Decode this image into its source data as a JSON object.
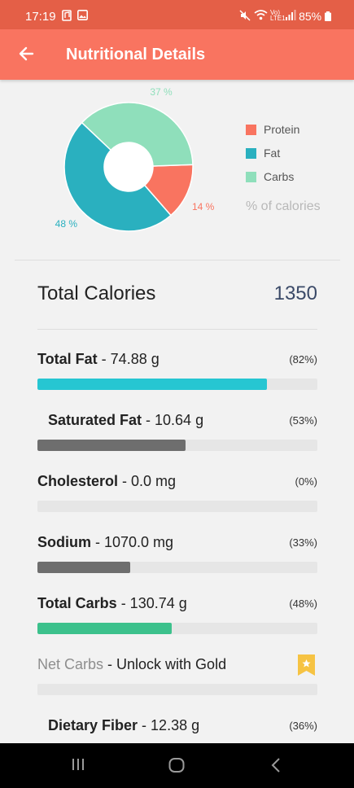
{
  "status_bar": {
    "time": "17:19",
    "battery": "85%",
    "icons": [
      "music-note-icon",
      "image-icon",
      "mute-icon",
      "wifi-icon",
      "volte-icon",
      "signal-icon",
      "battery-icon"
    ]
  },
  "app_bar": {
    "title": "Nutritional Details",
    "back_icon": "arrow-left-icon"
  },
  "chart_data": {
    "type": "pie",
    "donut": true,
    "unit": "% of calories",
    "series": [
      {
        "name": "Protein",
        "value": 14,
        "label": "14 %",
        "color": "#f97460"
      },
      {
        "name": "Fat",
        "value": 48,
        "label": "48 %",
        "color": "#2ab0bf"
      },
      {
        "name": "Carbs",
        "value": 37,
        "label": "37 %",
        "color": "#8fdfbb"
      }
    ],
    "legend_placement": "right"
  },
  "legend": {
    "note": "% of calories"
  },
  "total_calories": {
    "label": "Total Calories",
    "value": "1350"
  },
  "nutrients": [
    {
      "name": "Total Fat",
      "amount": " - 74.88 g",
      "percent_label": "(82%)",
      "fraction": 0.82,
      "color": "#26c6d2",
      "indent": false
    },
    {
      "name": "Saturated Fat",
      "amount": " - 10.64 g",
      "percent_label": "(53%)",
      "fraction": 0.53,
      "color": "#6e6e6e",
      "indent": true
    },
    {
      "name": "Cholesterol",
      "amount": " - 0.0 mg",
      "percent_label": "(0%)",
      "fraction": 0.0,
      "color": "#6e6e6e",
      "indent": false
    },
    {
      "name": "Sodium",
      "amount": " - 1070.0 mg",
      "percent_label": "(33%)",
      "fraction": 0.33,
      "color": "#6e6e6e",
      "indent": false
    },
    {
      "name": "Total Carbs",
      "amount": " - 130.74 g",
      "percent_label": "(48%)",
      "fraction": 0.48,
      "color": "#3cc18c",
      "indent": false
    },
    {
      "name": "Net Carbs",
      "amount": " - Unlock with Gold",
      "percent_label": "",
      "fraction": 0.0,
      "color": "#6e6e6e",
      "indent": false,
      "locked": true,
      "lock_icon": "gold-star-bookmark-icon"
    },
    {
      "name": "Dietary Fiber",
      "amount": " - 12.38 g",
      "percent_label": "(36%)",
      "fraction": 0.36,
      "color": "#6e6e6e",
      "indent": true
    }
  ],
  "nav_bar": {
    "icons": [
      "recent-apps-icon",
      "home-icon",
      "back-icon"
    ]
  }
}
